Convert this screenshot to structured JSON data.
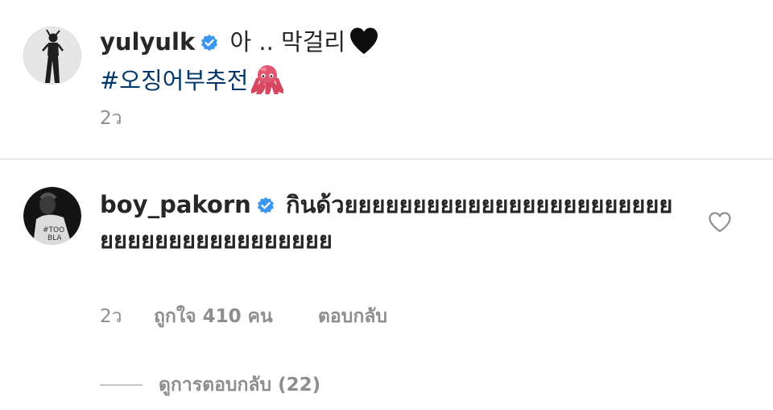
{
  "post": {
    "username": "yulyulk",
    "caption_text": "아 .. 막걸리",
    "hashtag": "#오징어부추전",
    "time": "2ว"
  },
  "comment": {
    "username": "boy_pakorn",
    "text": "กินด้วยยยยยยยยยยยยยยยยยยยยยยยยยยยยยยยยยยยยยยยยย",
    "time": "2ว",
    "likes": "ถูกใจ 410 คน",
    "reply_label": "ตอบกลับ",
    "view_replies": "ดูการตอบกลับ (22)"
  },
  "colors": {
    "text": "#262626",
    "muted": "#8e8e8e",
    "hashtag": "#00376b",
    "verified": "#3897f0",
    "divider": "#dbdbdb"
  },
  "icons": {
    "verified": "verified-badge-icon",
    "black_heart_emoji": "black-heart-emoji-icon",
    "octopus_emoji": "octopus-emoji-icon",
    "like": "heart-outline-icon"
  }
}
